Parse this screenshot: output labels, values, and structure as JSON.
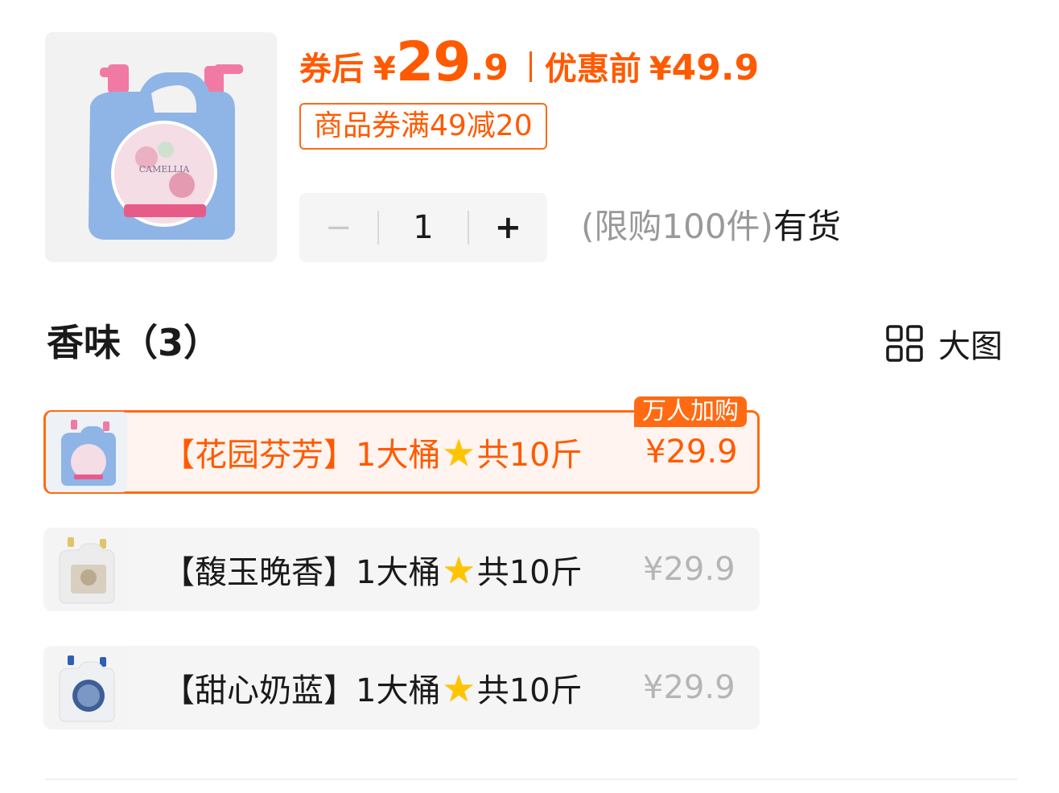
{
  "product": {
    "image_icon": "laundry-detergent-jug-blue"
  },
  "price": {
    "after_coupon_label": "券后",
    "currency": "¥",
    "after_coupon_int": "29",
    "after_coupon_dec": ".9",
    "original_label": "优惠前",
    "original_price": "49.9"
  },
  "coupon": {
    "label": "商品券满49减20"
  },
  "quantity": {
    "minus": "−",
    "value": "1",
    "plus": "+"
  },
  "stock": {
    "limit": "(限购100件)",
    "status": "有货"
  },
  "section": {
    "title": "香味（3）",
    "view_label": "大图",
    "view_icon": "grid-view-icon"
  },
  "options": [
    {
      "label_start": "【花园芬芳】1大桶",
      "star": "★",
      "label_end": "共10斤",
      "price": "¥29.9",
      "selected": true,
      "badge": "万人加购",
      "thumb": "blue-jug"
    },
    {
      "label_start": "【馥玉晚香】1大桶",
      "star": "★",
      "label_end": "共10斤",
      "price": "¥29.9",
      "selected": false,
      "thumb": "white-jug-gold"
    },
    {
      "label_start": "【甜心奶蓝】1大桶",
      "star": "★",
      "label_end": "共10斤",
      "price": "¥29.9",
      "selected": false,
      "thumb": "white-jug-blue"
    }
  ],
  "colors": {
    "accent": "#ff5a00",
    "selected_bg": "#fff4ef",
    "option_bg": "#f5f5f5",
    "muted": "#999999"
  }
}
